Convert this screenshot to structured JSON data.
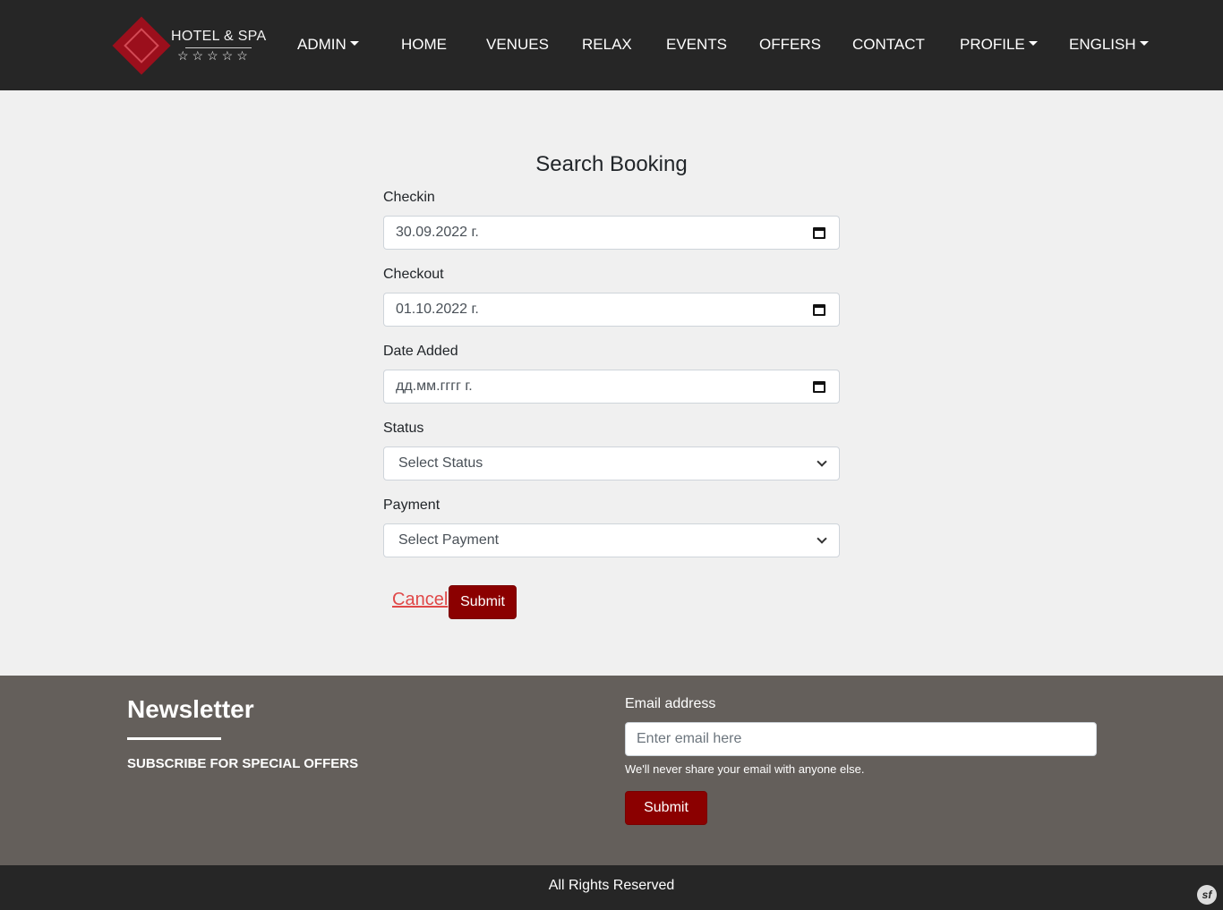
{
  "nav": {
    "logo_text": "HOTEL & SPA",
    "logo_stars": "☆☆☆☆☆",
    "items": [
      {
        "label": "ADMIN",
        "dropdown": true
      },
      {
        "label": "HOME"
      },
      {
        "label": "VENUES"
      },
      {
        "label": "RELAX"
      },
      {
        "label": "EVENTS"
      },
      {
        "label": "OFFERS"
      },
      {
        "label": "CONTACT"
      },
      {
        "label": "PROFILE",
        "dropdown": true
      },
      {
        "label": "ENGLISH",
        "dropdown": true
      }
    ]
  },
  "form": {
    "title": "Search Booking",
    "checkin": {
      "label": "Checkin",
      "value": "30.09.2022 г."
    },
    "checkout": {
      "label": "Checkout",
      "value": "01.10.2022 г."
    },
    "date_added": {
      "label": "Date Added",
      "value": "дд.мм.гггг г."
    },
    "status": {
      "label": "Status",
      "selected": "Select Status"
    },
    "payment": {
      "label": "Payment",
      "selected": "Select Payment"
    },
    "cancel_label": "Cancel",
    "submit_label": "Submit"
  },
  "newsletter": {
    "title": "Newsletter",
    "subtitle": "SUBSCRIBE FOR SPECIAL OFFERS",
    "email_label": "Email address",
    "email_placeholder": "Enter email here",
    "help_text": "We'll never share your email with anyone else.",
    "submit_label": "Submit"
  },
  "footer": {
    "copyright": "All Rights Reserved",
    "badge": "sf"
  },
  "colors": {
    "nav_bg": "#262626",
    "brand_red": "#8b0000",
    "link_red": "#e04848",
    "newsletter_bg": "#645f5b"
  }
}
